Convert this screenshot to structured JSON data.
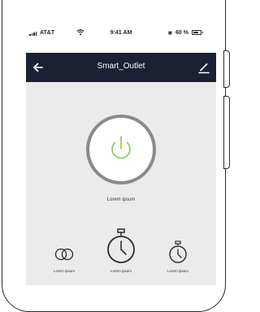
{
  "status_bar": {
    "carrier": "AT&T",
    "time": "9:41 AM",
    "battery_text": "60 %"
  },
  "navbar": {
    "title": "Smart_Outlet",
    "back_icon": "back-arrow-icon",
    "edit_icon": "edit-pencil-icon"
  },
  "power": {
    "label": "Lorem ipsum",
    "icon": "power-icon",
    "ring_color": "#8a8a8a",
    "icon_color": "#7bd04a"
  },
  "actions": [
    {
      "label": "Lorem ipsum",
      "icon": "overlap-circles-icon"
    },
    {
      "label": "Lorem ipsum",
      "icon": "stopwatch-icon"
    },
    {
      "label": "Lorem ipsum",
      "icon": "stopwatch-icon"
    }
  ],
  "colors": {
    "navbar_bg": "#1c2033",
    "content_bg": "#ebebeb"
  }
}
